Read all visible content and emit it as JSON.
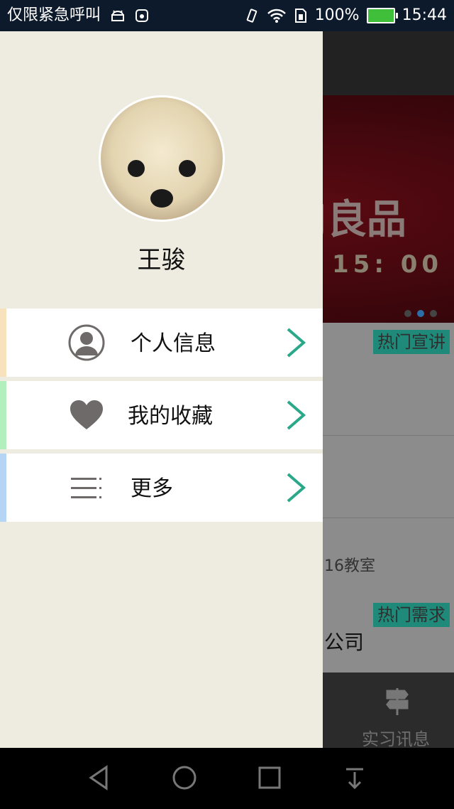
{
  "status_bar": {
    "left_text": "仅限紧急呼叫",
    "battery": "100%",
    "time": "15:44"
  },
  "background": {
    "banner_text": "J良品",
    "banner_time": "15: 00",
    "tag_hot_talk": "热门宣讲",
    "row_text": "16教室",
    "tag_hot_demand": "热门需求",
    "company_text": "公司",
    "bottom_tab_label": "实习讯息"
  },
  "drawer": {
    "username": "王骏",
    "menu": [
      {
        "label": "个人信息",
        "icon": "person-icon",
        "accent": "#f7e2bd"
      },
      {
        "label": "我的收藏",
        "icon": "heart-icon",
        "accent": "#b3efbd"
      },
      {
        "label": "更多",
        "icon": "list-icon",
        "accent": "#b6d4f3"
      }
    ]
  },
  "colors": {
    "arrow": "#2aa88a",
    "drawer_bg": "#eeebe0",
    "icon_gray": "#6e6a6a"
  }
}
